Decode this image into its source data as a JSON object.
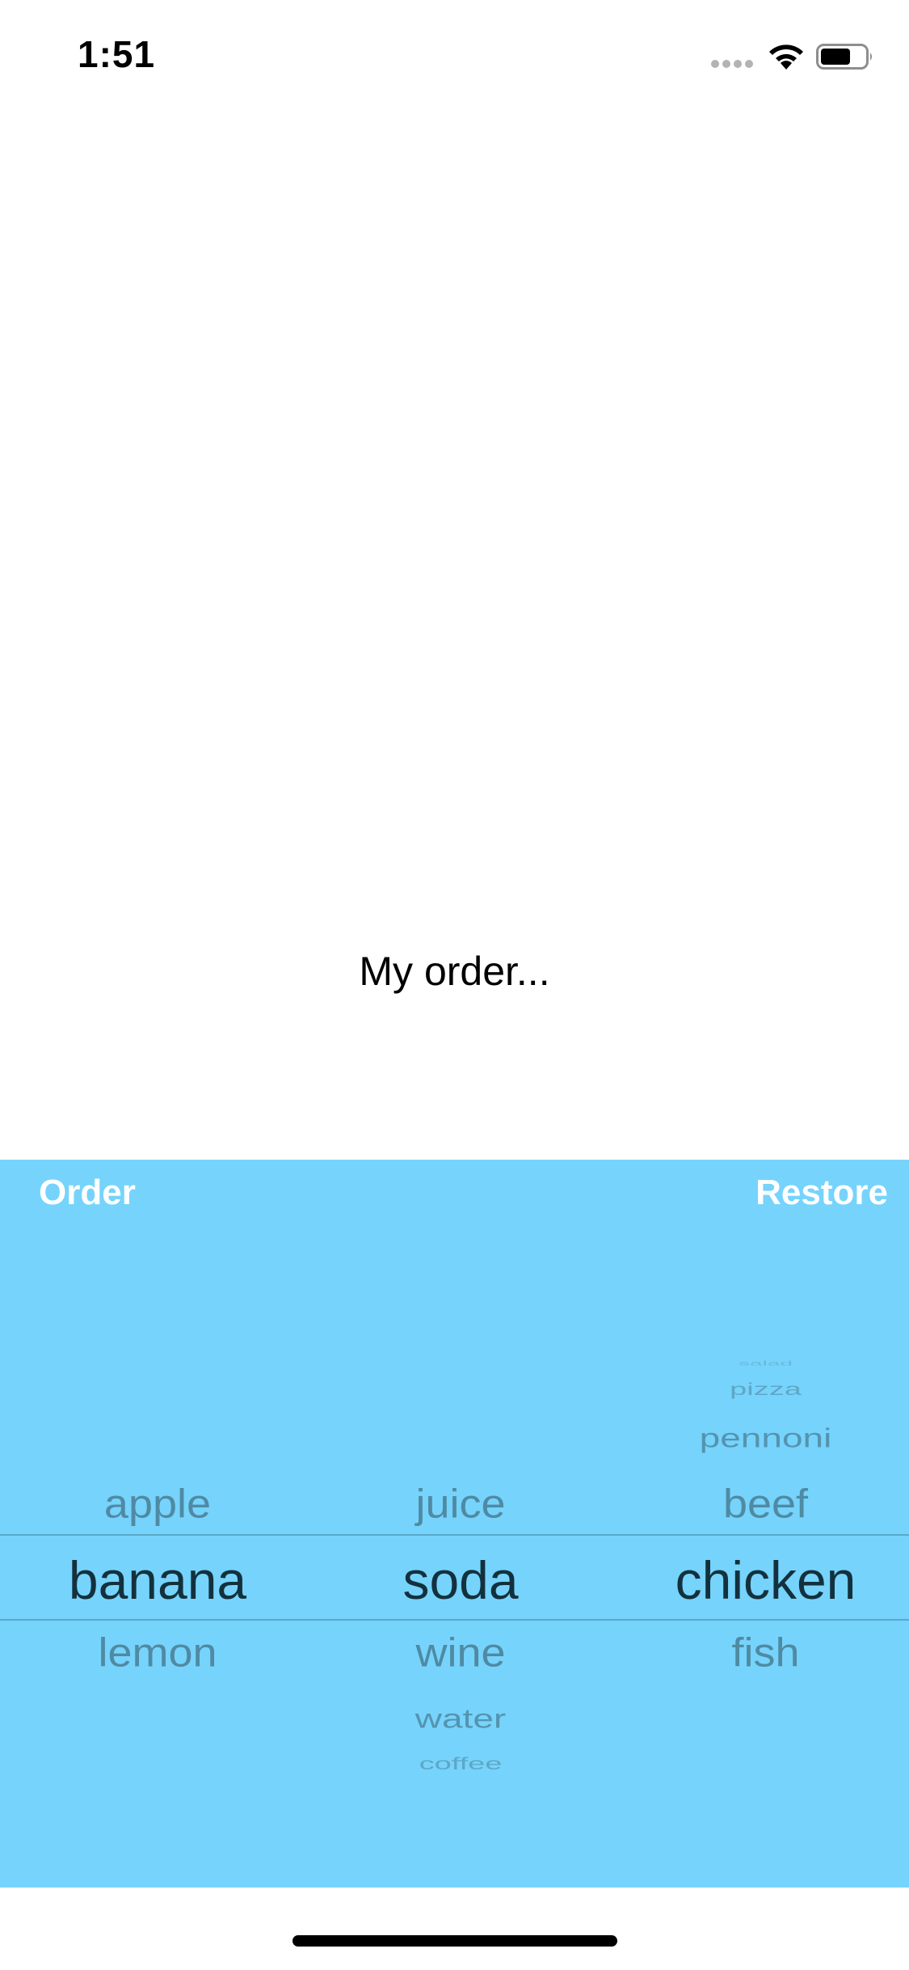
{
  "status_bar": {
    "time": "1:51",
    "icons": [
      "cellular-signal-icon",
      "wifi-icon",
      "battery-icon"
    ]
  },
  "main": {
    "order_label": "My order..."
  },
  "toolbar": {
    "order_label": "Order",
    "restore_label": "Restore"
  },
  "picker": {
    "background_color": "#76d3fc",
    "columns": [
      {
        "items_above": [
          "apple"
        ],
        "selected": "banana",
        "items_below": [
          "lemon"
        ]
      },
      {
        "items_above": [
          "juice"
        ],
        "selected": "soda",
        "items_below": [
          "wine",
          "water",
          "coffee"
        ]
      },
      {
        "items_above": [
          "salad",
          "pizza",
          "pennoni",
          "beef"
        ],
        "selected": "chicken",
        "items_below": [
          "fish"
        ]
      }
    ]
  }
}
